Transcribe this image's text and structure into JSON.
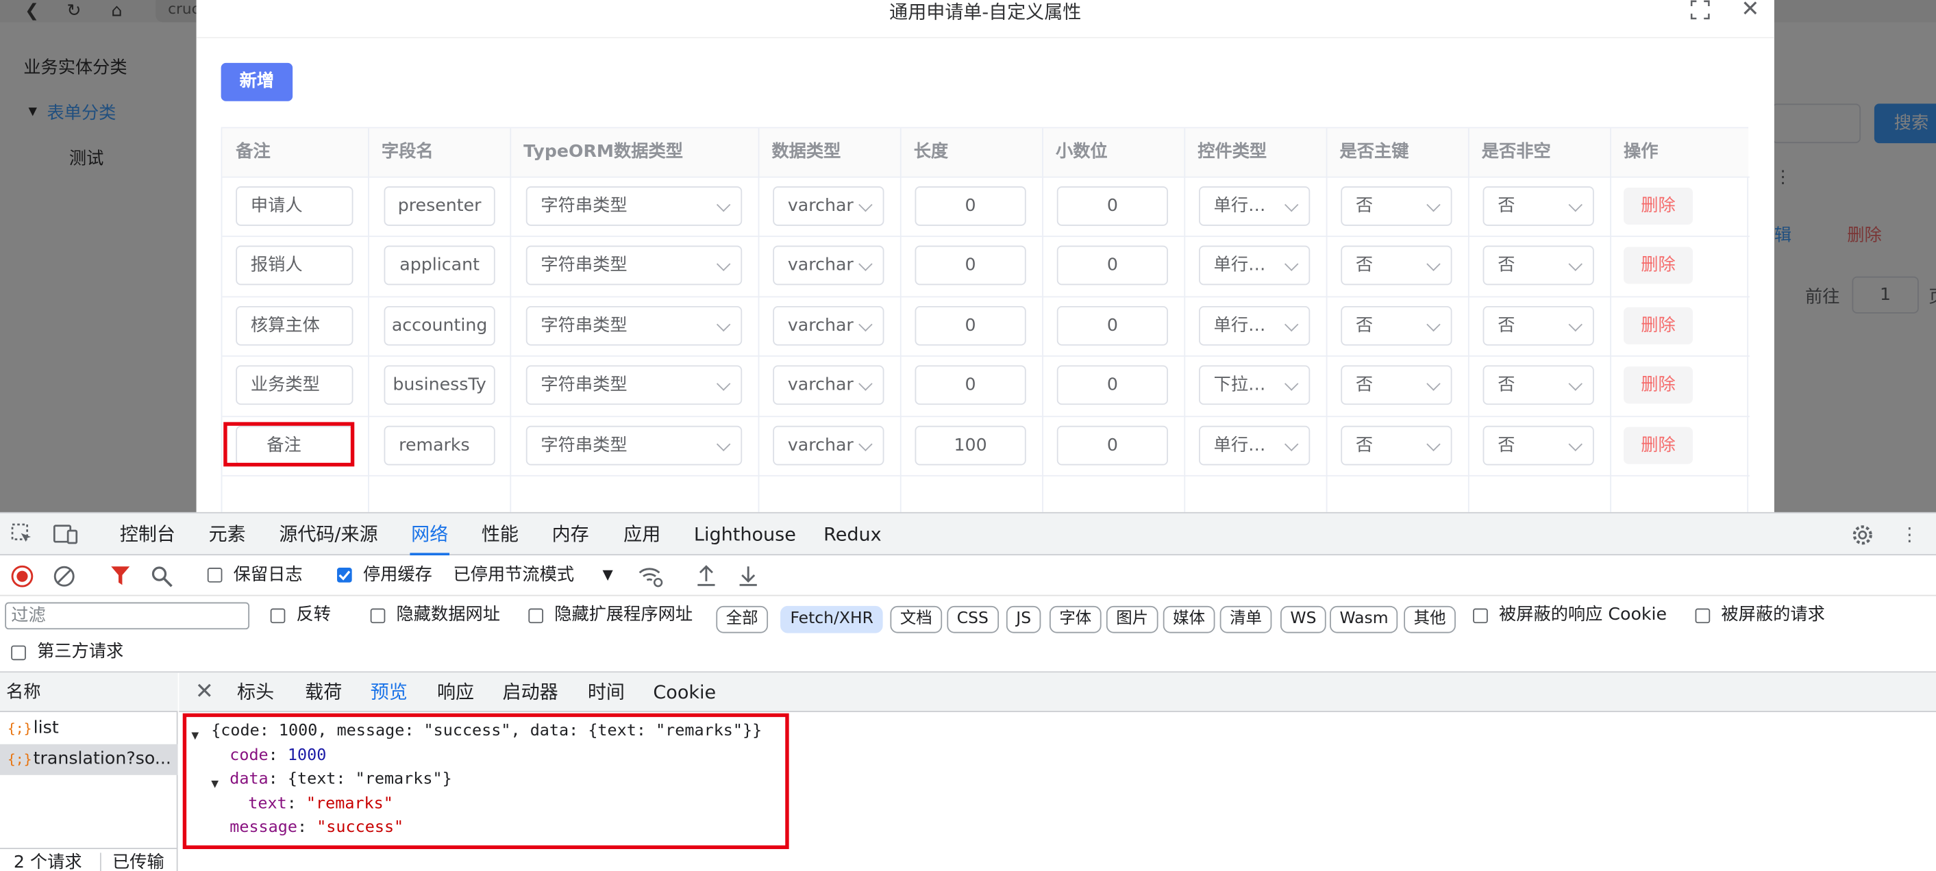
{
  "browser": {
    "url_fragment": "cruc"
  },
  "sidebar": {
    "title": "业务实体分类",
    "group": "表单分类",
    "child": "测试"
  },
  "background": {
    "search_button": "搜索",
    "edit_link": "辑",
    "delete_link": "删除",
    "goto_label": "前往",
    "page_value": "1",
    "page_suffix": "页"
  },
  "dialog": {
    "title": "通用申请单-自定义属性",
    "add_button": "新增",
    "columns": [
      "备注",
      "字段名",
      "TypeORM数据类型",
      "数据类型",
      "长度",
      "小数位",
      "控件类型",
      "是否主键",
      "是否非空",
      "操作"
    ],
    "rows": [
      {
        "remark": "申请人",
        "field": "presenter",
        "orm_type": "字符串类型",
        "data_type": "varchar",
        "length": "0",
        "decimals": "0",
        "control": "单行…",
        "primary": "否",
        "not_null": "否",
        "action": "删除"
      },
      {
        "remark": "报销人",
        "field": "applicant",
        "orm_type": "字符串类型",
        "data_type": "varchar",
        "length": "0",
        "decimals": "0",
        "control": "单行…",
        "primary": "否",
        "not_null": "否",
        "action": "删除"
      },
      {
        "remark": "核算主体",
        "field": "accounting",
        "orm_type": "字符串类型",
        "data_type": "varchar",
        "length": "0",
        "decimals": "0",
        "control": "单行…",
        "primary": "否",
        "not_null": "否",
        "action": "删除"
      },
      {
        "remark": "业务类型",
        "field": "businessTy",
        "orm_type": "字符串类型",
        "data_type": "varchar",
        "length": "0",
        "decimals": "0",
        "control": "下拉…",
        "primary": "否",
        "not_null": "否",
        "action": "删除"
      },
      {
        "remark": "备注",
        "field": "remarks",
        "orm_type": "字符串类型",
        "data_type": "varchar",
        "length": "100",
        "decimals": "0",
        "control": "单行…",
        "primary": "否",
        "not_null": "否",
        "action": "删除"
      }
    ]
  },
  "devtools": {
    "tabs": [
      "控制台",
      "元素",
      "源代码/来源",
      "网络",
      "性能",
      "内存",
      "应用",
      "Lighthouse",
      "Redux"
    ],
    "active_tab": "网络",
    "toolbar": {
      "preserve_log": "保留日志",
      "disable_cache": "停用缓存",
      "throttle": "已停用节流模式"
    },
    "filter": {
      "placeholder": "过滤",
      "invert": "反转",
      "hide_data_urls": "隐藏数据网址",
      "hide_ext_urls": "隐藏扩展程序网址",
      "chips": [
        "全部",
        "Fetch/XHR",
        "文档",
        "CSS",
        "JS",
        "字体",
        "图片",
        "媒体",
        "清单",
        "WS",
        "Wasm",
        "其他"
      ],
      "blocked_cookies": "被屏蔽的响应 Cookie",
      "blocked_requests": "被屏蔽的请求",
      "third_party": "第三方请求"
    },
    "name_header": "名称",
    "requests": [
      "list",
      "translation?so..."
    ],
    "status": {
      "count": "2 个请求",
      "transferred": "已传输"
    },
    "detail_tabs": [
      "标头",
      "载荷",
      "预览",
      "响应",
      "启动器",
      "时间",
      "Cookie"
    ],
    "active_detail_tab": "预览",
    "preview": {
      "summary": "{code: 1000, message: \"success\", data: {text: \"remarks\"}}",
      "code_key": "code",
      "code_value": "1000",
      "data_key": "data",
      "data_summary": "{text: \"remarks\"}",
      "text_key": "text",
      "text_value": "\"remarks\"",
      "message_key": "message",
      "message_value": "\"success\""
    }
  },
  "colors": {
    "primary": "#5c7cf5",
    "danger": "#f56c6c",
    "highlight": "#e60012",
    "devtools_active": "#1a73e8"
  }
}
